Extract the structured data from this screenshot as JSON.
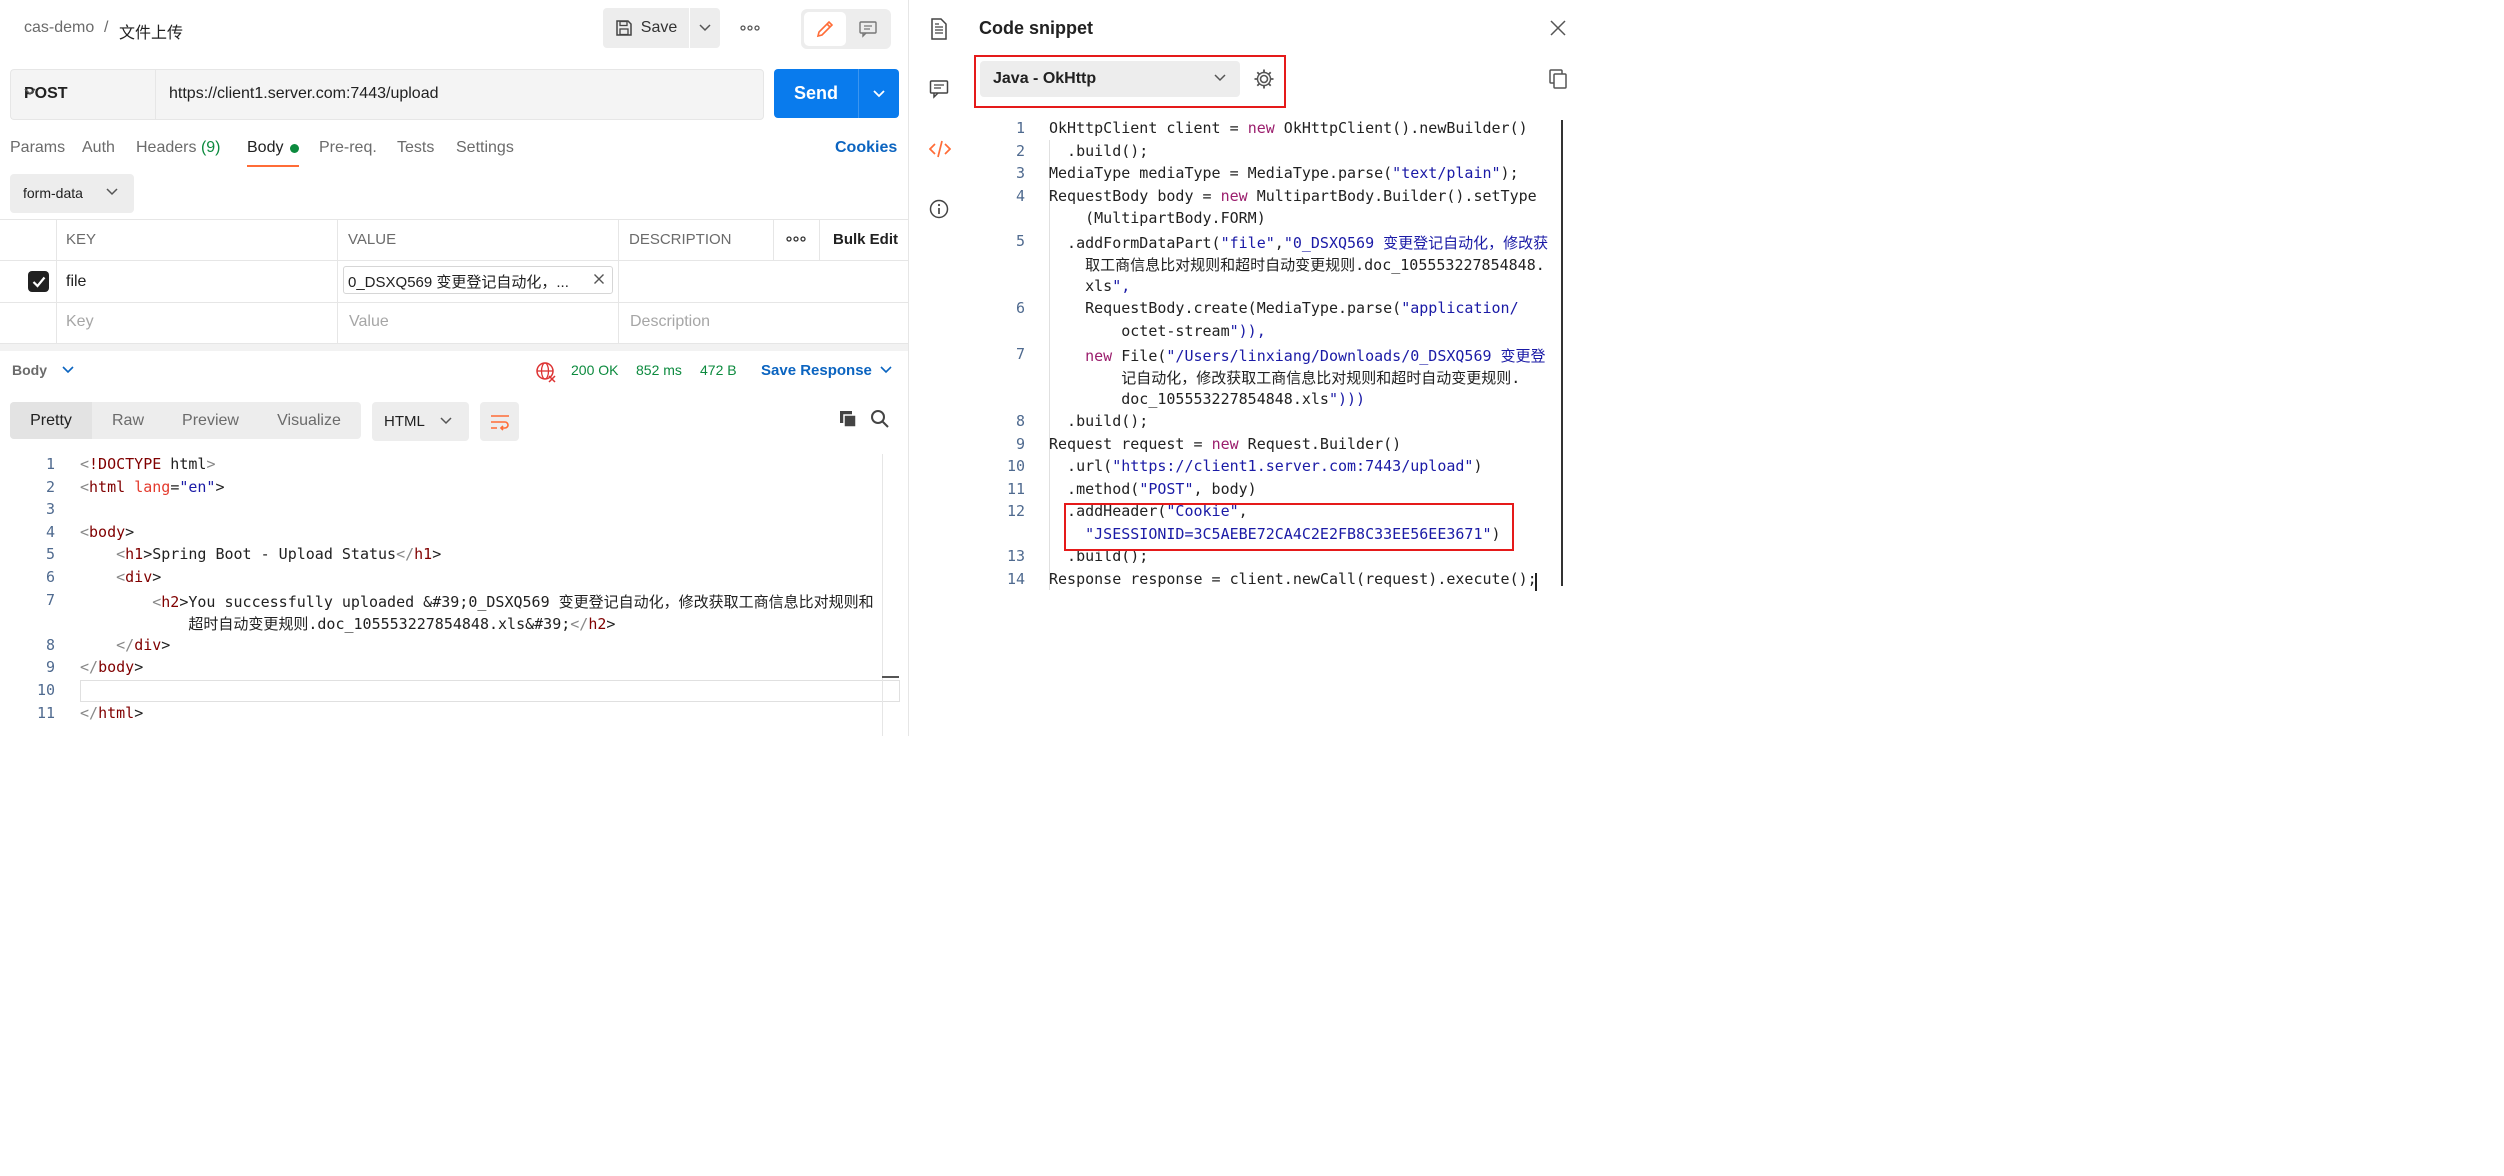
{
  "breadcrumb": {
    "workspace": "cas-demo",
    "separator": "/",
    "request_name": "文件上传"
  },
  "toolbar": {
    "save_label": "Save"
  },
  "request": {
    "method": "POST",
    "url": "https://client1.server.com:7443/upload",
    "send_label": "Send"
  },
  "tabs": {
    "params": "Params",
    "auth": "Auth",
    "headers": "Headers",
    "headers_count": "(9)",
    "body": "Body",
    "prereq": "Pre-req.",
    "tests": "Tests",
    "settings": "Settings",
    "cookies": "Cookies"
  },
  "body_type": "form-data",
  "table": {
    "headers": {
      "key": "KEY",
      "value": "VALUE",
      "description": "DESCRIPTION",
      "bulk_edit": "Bulk Edit"
    },
    "rows": [
      {
        "checked": true,
        "key": "file",
        "value": "0_DSXQ569 变更登记自动化，...",
        "description": ""
      }
    ],
    "placeholder": {
      "key": "Key",
      "value": "Value",
      "description": "Description"
    }
  },
  "response": {
    "section_label": "Body",
    "status": "200 OK",
    "time": "852 ms",
    "size": "472 B",
    "save_response": "Save Response",
    "views": [
      "Pretty",
      "Raw",
      "Preview",
      "Visualize"
    ],
    "active_view": "Pretty",
    "language": "HTML",
    "code": [
      {
        "n": "1",
        "t": "<!DOCTYPE html>"
      },
      {
        "n": "2",
        "t": "<html lang=\"en\">"
      },
      {
        "n": "3",
        "t": ""
      },
      {
        "n": "4",
        "t": "<body>"
      },
      {
        "n": "5",
        "t": "    <h1>Spring Boot - Upload Status</h1>"
      },
      {
        "n": "6",
        "t": "    <div>"
      },
      {
        "n": "7",
        "t": "        <h2>You successfully uploaded &#39;0_DSXQ569 变更登记自动化，修改获取工商信息比对规则和"
      },
      {
        "n": "",
        "t": "            超时自动变更规则.doc_105553227854848.xls&#39;</h2>"
      },
      {
        "n": "8",
        "t": "    </div>"
      },
      {
        "n": "9",
        "t": "</body>"
      },
      {
        "n": "10",
        "t": ""
      },
      {
        "n": "11",
        "t": "</html>"
      }
    ]
  },
  "snippet": {
    "title": "Code snippet",
    "language": "Java - OkHttp",
    "code": [
      {
        "n": "1",
        "t": "OkHttpClient client = new OkHttpClient().newBuilder()"
      },
      {
        "n": "2",
        "t": "  .build();"
      },
      {
        "n": "3",
        "t": "MediaType mediaType = MediaType.parse(\"text/plain\");"
      },
      {
        "n": "4",
        "t": "RequestBody body = new MultipartBody.Builder().setType"
      },
      {
        "n": "",
        "t": "    (MultipartBody.FORM)"
      },
      {
        "n": "5",
        "t": "  .addFormDataPart(\"file\",\"0_DSXQ569 变更登记自动化，修改获"
      },
      {
        "n": "",
        "t": "    取工商信息比对规则和超时自动变更规则.doc_105553227854848."
      },
      {
        "n": "",
        "t": "    xls\","
      },
      {
        "n": "6",
        "t": "    RequestBody.create(MediaType.parse(\"application/"
      },
      {
        "n": "",
        "t": "        octet-stream\")),"
      },
      {
        "n": "7",
        "t": "    new File(\"/Users/linxiang/Downloads/0_DSXQ569 变更登"
      },
      {
        "n": "",
        "t": "        记自动化，修改获取工商信息比对规则和超时自动变更规则."
      },
      {
        "n": "",
        "t": "        doc_105553227854848.xls\")))"
      },
      {
        "n": "8",
        "t": "  .build();"
      },
      {
        "n": "9",
        "t": "Request request = new Request.Builder()"
      },
      {
        "n": "10",
        "t": "  .url(\"https://client1.server.com:7443/upload\")"
      },
      {
        "n": "11",
        "t": "  .method(\"POST\", body)"
      },
      {
        "n": "12",
        "t": "  .addHeader(\"Cookie\","
      },
      {
        "n": "",
        "t": "    \"JSESSIONID=3C5AEBE72CA4C2E2FB8C33EE56EE3671\")"
      },
      {
        "n": "13",
        "t": "  .build();"
      },
      {
        "n": "14",
        "t": "Response response = client.newCall(request).execute();"
      }
    ]
  },
  "colors": {
    "accent_orange": "#ff6c37",
    "send_blue": "#097bed",
    "status_green": "#0c8a3e",
    "link_blue": "#0b64c0",
    "highlight_red": "#e51a1a"
  },
  "icons": {
    "save": "floppy-disk-icon",
    "edit": "pencil-icon",
    "comment": "comment-icon",
    "sidebar": [
      "document-icon",
      "comment-icon",
      "code-icon",
      "info-icon"
    ],
    "settings": "gear-icon",
    "copy": "copy-icon",
    "close": "close-icon"
  }
}
